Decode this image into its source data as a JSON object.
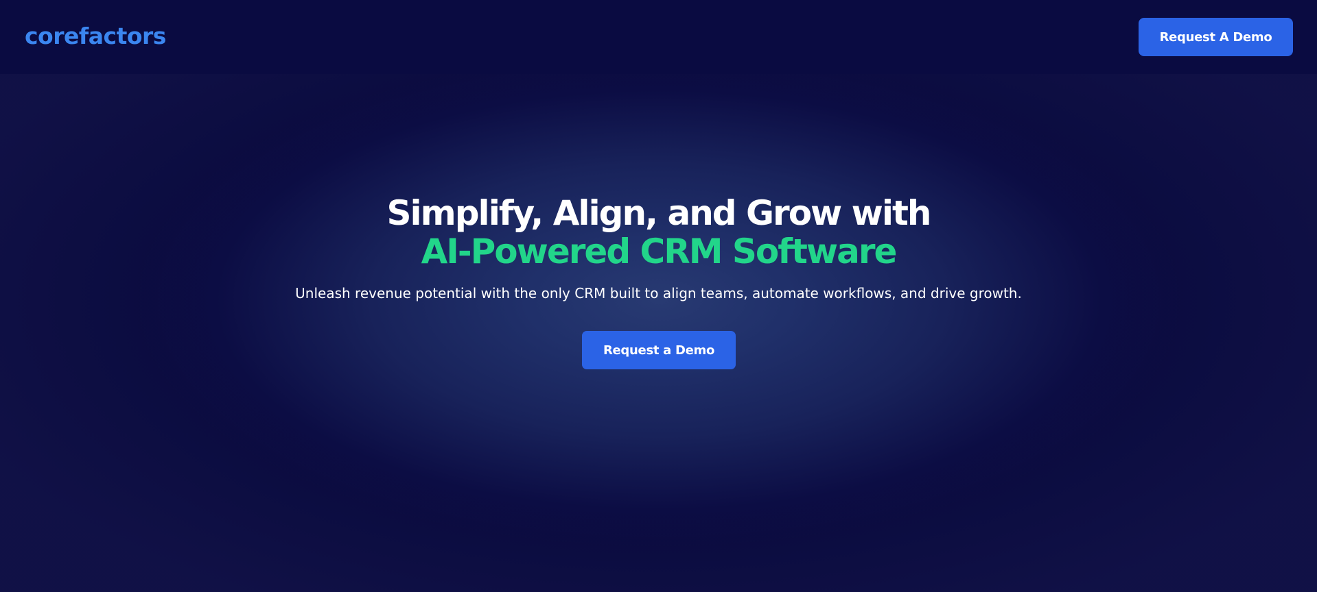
{
  "header": {
    "logo_text": "corefactors",
    "cta_label": "Request A Demo"
  },
  "hero": {
    "headline_line1": "Simplify, Align, and Grow with",
    "headline_line2": "AI-Powered CRM Software",
    "subtitle": "Unleash revenue potential with the only CRM built to align teams, automate workflows, and drive growth.",
    "cta_label": "Request a Demo"
  },
  "colors": {
    "background": "#0a0b3f",
    "brand_blue": "#3b86f0",
    "button_blue": "#2b63e6",
    "accent_green": "#22d58a",
    "text_white": "#ffffff"
  }
}
